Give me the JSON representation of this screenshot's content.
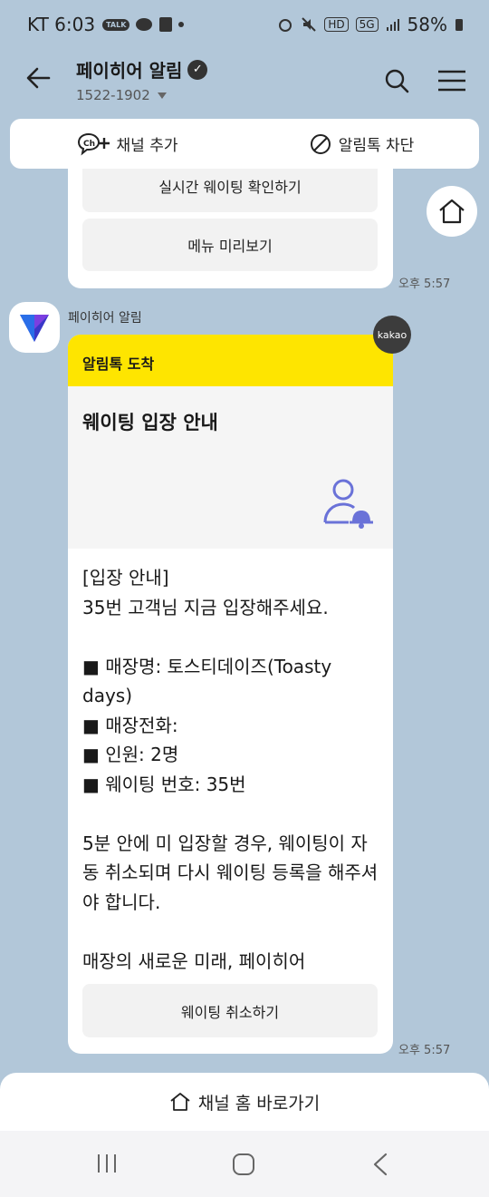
{
  "status": {
    "carrier_time": "KT 6:03",
    "pill1": "TALK",
    "battery": "58%",
    "hd": "HD",
    "net": "5G"
  },
  "header": {
    "title": "페이히어 알림",
    "verified_mark": "✓",
    "phone": "1522-1902"
  },
  "channel_bar": {
    "add_label": "채널 추가",
    "block_label": "알림톡 차단"
  },
  "prev_card": {
    "button1": "실시간 웨이팅 확인하기",
    "button2": "메뉴 미리보기",
    "time": "오후 5:57"
  },
  "message": {
    "sender": "페이히어 알림",
    "badge": "kakao",
    "head": "알림톡 도착",
    "hero_title": "웨이팅 입장 안내",
    "body": "[입장 안내]\n35번 고객님 지금 입장해주세요.\n\n■ 매장명: 토스티데이즈(Toasty days)\n■ 매장전화:\n■ 인원: 2명\n■ 웨이팅 번호: 35번\n\n5분 안에 미 입장할 경우, 웨이팅이 자동 취소되며 다시 웨이팅 등록을 해주셔야 합니다.\n\n매장의 새로운 미래, 페이히어",
    "cancel_button": "웨이팅 취소하기",
    "time": "오후 5:57"
  },
  "bottom_bar": {
    "label": "채널 홈 바로가기"
  },
  "colors": {
    "background": "#b2c7d9",
    "kakao_yellow": "#fee500",
    "icon_purple": "#6a72d8"
  }
}
